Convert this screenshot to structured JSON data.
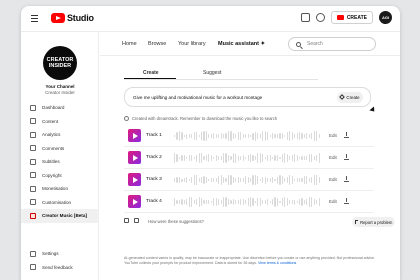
{
  "brand": {
    "logo_text": "Studio"
  },
  "topbar": {
    "create_label": "CREATE",
    "avatar_text": "AGI"
  },
  "channel": {
    "avatar_line1": "CREATOR",
    "avatar_line2": "INSIDER",
    "title": "Your Channel",
    "name": "Creator Insider"
  },
  "sidebar": {
    "items": [
      {
        "label": "Dashboard",
        "icon": "dashboard-icon"
      },
      {
        "label": "Content",
        "icon": "content-icon"
      },
      {
        "label": "Analytics",
        "icon": "analytics-icon"
      },
      {
        "label": "Comments",
        "icon": "comments-icon"
      },
      {
        "label": "Subtitles",
        "icon": "subtitles-icon"
      },
      {
        "label": "Copyright",
        "icon": "copyright-icon"
      },
      {
        "label": "Monetisation",
        "icon": "monetisation-icon"
      },
      {
        "label": "Customisation",
        "icon": "customisation-icon"
      },
      {
        "label": "Creator Music [Beta]",
        "icon": "creator-music-icon",
        "active": true
      }
    ],
    "bottom": [
      {
        "label": "Settings",
        "icon": "gear-icon"
      },
      {
        "label": "Send feedback",
        "icon": "feedback-icon"
      }
    ]
  },
  "main": {
    "tabs": [
      "Home",
      "Browse",
      "Your library",
      "Music assistant"
    ],
    "active_tab": "Music assistant",
    "search_placeholder": "Search",
    "subtabs": [
      "Create",
      "Suggest"
    ],
    "prompt_text": "Give me uplifting and motivational music for a workout montage",
    "prompt_button": "Create",
    "note": "Created with dreamtrack. Remember to download the music you like to search",
    "tracks": [
      {
        "name": "Track 1",
        "edit": "Edit"
      },
      {
        "name": "Track 2",
        "edit": "Edit"
      },
      {
        "name": "Track 3",
        "edit": "Edit"
      },
      {
        "name": "Track 4",
        "edit": "Edit"
      }
    ],
    "feedback_question": "How were these suggestions?",
    "report_label": "Report a problem",
    "disclaimer_1": "AI-generated content varies in quality, may be inaccurate or inappropriate. Use discretion before you create or use anything provided. Not professional advice.",
    "disclaimer_2": "YouTube collects your prompts for product improvement. Data is stored for 36 days.",
    "disclaimer_link": "View terms & conditions"
  },
  "colors": {
    "accent_red": "#ff0000",
    "track_gradient_start": "#e0197b",
    "track_gradient_end": "#8a2be2"
  }
}
